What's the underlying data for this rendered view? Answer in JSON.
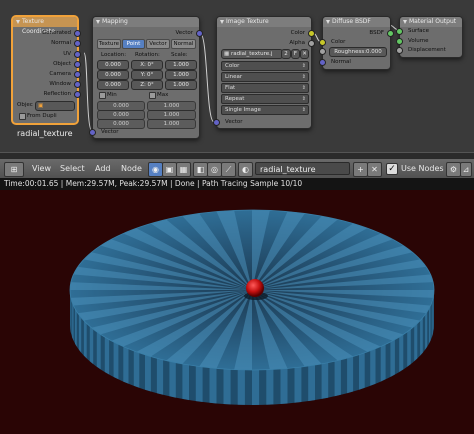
{
  "nodes": {
    "texcoord": {
      "title": "Texture Coordinate",
      "outputs": [
        "Generated",
        "Normal",
        "UV",
        "Object",
        "Camera",
        "Window",
        "Reflection"
      ],
      "object_label": "Objec",
      "dupli_label": "From Dupli",
      "name_label": "radial_texture"
    },
    "mapping": {
      "title": "Mapping",
      "output": "Vector",
      "tabs": [
        "Texture",
        "Point",
        "Vector",
        "Normal"
      ],
      "active_tab": "Point",
      "cols": [
        "Location:",
        "Rotation:",
        "Scale:"
      ],
      "loc": [
        "0.000",
        "0.000",
        "0.000"
      ],
      "rot": [
        "X: 0°",
        "Y: 0°",
        "Z: 0°"
      ],
      "scale": [
        "1.000",
        "1.000",
        "1.000"
      ],
      "min_label": "Min",
      "max_label": "Max",
      "min": [
        "0.000",
        "0.000",
        "0.000"
      ],
      "max": [
        "1.000",
        "1.000",
        "1.000"
      ],
      "input": "Vector"
    },
    "image": {
      "title": "Image Texture",
      "outputs": [
        "Color",
        "Alpha"
      ],
      "image_name": "radial_texture.j",
      "image_users": "2",
      "f_label": "F",
      "dropdowns": [
        "Color",
        "Linear",
        "Flat",
        "Repeat",
        "Single Image"
      ],
      "input": "Vector"
    },
    "diffuse": {
      "title": "Diffuse BSDF",
      "output": "BSDF",
      "color_label": "Color",
      "roughness": "Roughness:0.000",
      "normal_label": "Normal"
    },
    "output": {
      "title": "Material Output",
      "inputs": [
        "Surface",
        "Volume",
        "Displacement"
      ]
    }
  },
  "header": {
    "menus": [
      "View",
      "Select",
      "Add",
      "Node"
    ],
    "material_name": "radial_texture",
    "use_nodes_label": "Use Nodes",
    "use_nodes_checked": true
  },
  "status": {
    "text": "Time:00:01.65 | Mem:29.57M, Peak:29.57M | Done | Path Tracing Sample 10/10"
  },
  "colors": {
    "accent": "#5680c2",
    "selected_node": "#f1a23a",
    "render_background": "#2a0505",
    "disc_blue": "#2f6e96",
    "sphere": "#c41010"
  }
}
